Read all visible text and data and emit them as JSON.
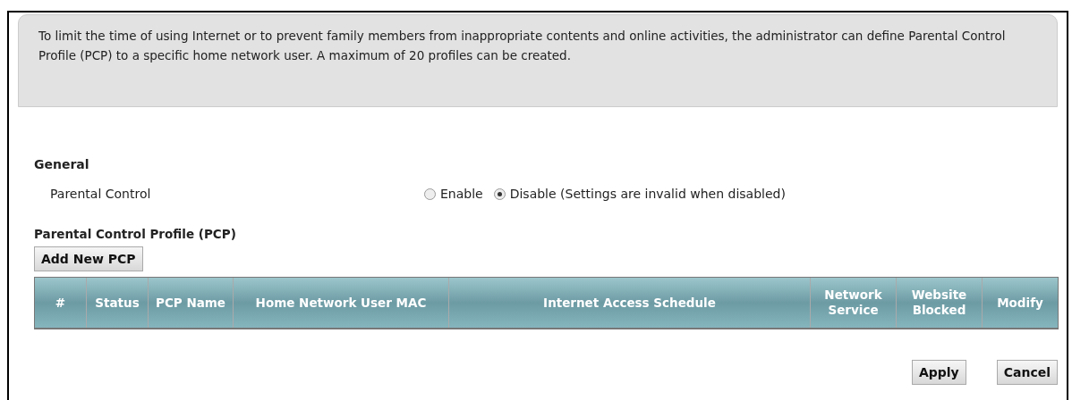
{
  "intro": "To limit the time of using Internet or to prevent family members from inappropriate contents and online activities, the administrator can define Parental Control Profile (PCP) to a specific home network user. A maximum of 20 profiles can be created.",
  "general": {
    "heading": "General",
    "label": "Parental Control",
    "options": [
      {
        "label": "Enable",
        "selected": false
      },
      {
        "label": "Disable (Settings are invalid when disabled)",
        "selected": true
      }
    ]
  },
  "pcp": {
    "heading": "Parental Control Profile (PCP)",
    "add_button": "Add New PCP",
    "columns": [
      "#",
      "Status",
      "PCP Name",
      "Home Network User MAC",
      "Internet Access Schedule",
      "Network Service",
      "Website Blocked",
      "Modify"
    ]
  },
  "buttons": [
    "Apply",
    "Cancel"
  ]
}
